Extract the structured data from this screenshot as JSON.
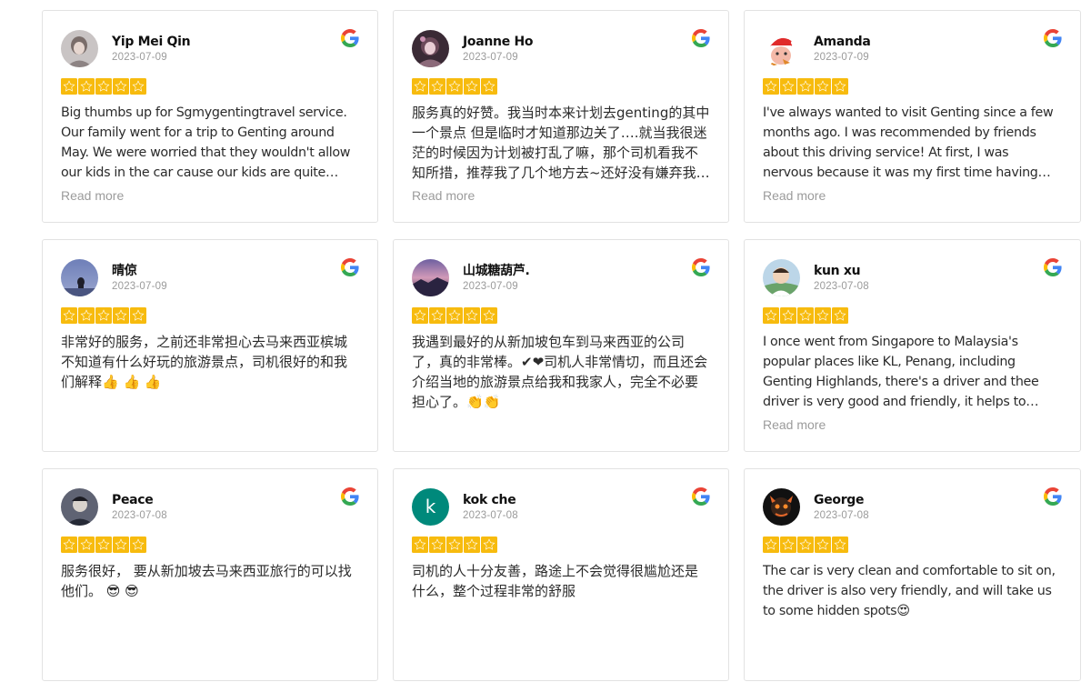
{
  "colors": {
    "star": "#f7bb0e",
    "date": "#9a9a9a",
    "read_more": "#9b9b9b",
    "card_border": "#e2e2e2"
  },
  "source_icon": "google-g-icon",
  "reviews": [
    {
      "name": "Yip Mei Qin",
      "date": "2023-07-09",
      "rating": 5,
      "avatar": "photo",
      "text": "Big thumbs up for Sgmygentingtravel service. Our family went for a trip to Genting around May. We were worried that they wouldn't allow our kids in the car cause our kids are quite…",
      "read_more": "Read more"
    },
    {
      "name": "Joanne Ho",
      "date": "2023-07-09",
      "rating": 5,
      "avatar": "photo",
      "text": "服务真的好赞。我当时本来计划去genting的其中一个景点 但是临时才知道那边关了….就当我很迷茫的时候因为计划被打乱了嘛，那个司机看我不知所措，推荐我了几个地方去~还好没有嫌弃我…",
      "read_more": "Read more"
    },
    {
      "name": "Amanda",
      "date": "2023-07-09",
      "rating": 5,
      "avatar": "illustration",
      "text": "I've always wanted to visit Genting since a few months ago. I was recommended by friends about this driving service! At first, I was nervous because it was my first time having…",
      "read_more": "Read more"
    },
    {
      "name": "晴倞",
      "date": "2023-07-09",
      "rating": 5,
      "avatar": "photo",
      "text": "非常好的服务，之前还非常担心去马来西亚槟城不知道有什么好玩的旅游景点，司机很好的和我们解释👍 👍 👍"
    },
    {
      "name": "山城糖葫芦.",
      "date": "2023-07-09",
      "rating": 5,
      "avatar": "photo",
      "text": "我遇到最好的从新加坡包车到马来西亚的公司了，真的非常棒。✔❤司机人非常情切，而且还会介绍当地的旅游景点给我和我家人，完全不必要担心了。👏👏"
    },
    {
      "name": "kun xu",
      "date": "2023-07-08",
      "rating": 5,
      "avatar": "photo",
      "text": "I once went from Singapore to Malaysia's popular places like KL, Penang, including Genting Highlands, there's a driver and thee driver is very good and friendly, it helps to…",
      "read_more": "Read more"
    },
    {
      "name": "Peace",
      "date": "2023-07-08",
      "rating": 5,
      "avatar": "photo",
      "text": "服务很好， 要从新加坡去马来西亚旅行的可以找他们。 😎 😎"
    },
    {
      "name": "kok che",
      "date": "2023-07-08",
      "rating": 5,
      "avatar": "letter",
      "avatar_letter": "k",
      "avatar_color": "#00897b",
      "text": "司机的人十分友善，路途上不会觉得很尴尬还是什么，整个过程非常的舒服"
    },
    {
      "name": "George",
      "date": "2023-07-08",
      "rating": 5,
      "avatar": "photo",
      "text": "The car is very clean and comfortable to sit on, the driver is also very friendly, and will take us to some hidden spots😍"
    }
  ]
}
